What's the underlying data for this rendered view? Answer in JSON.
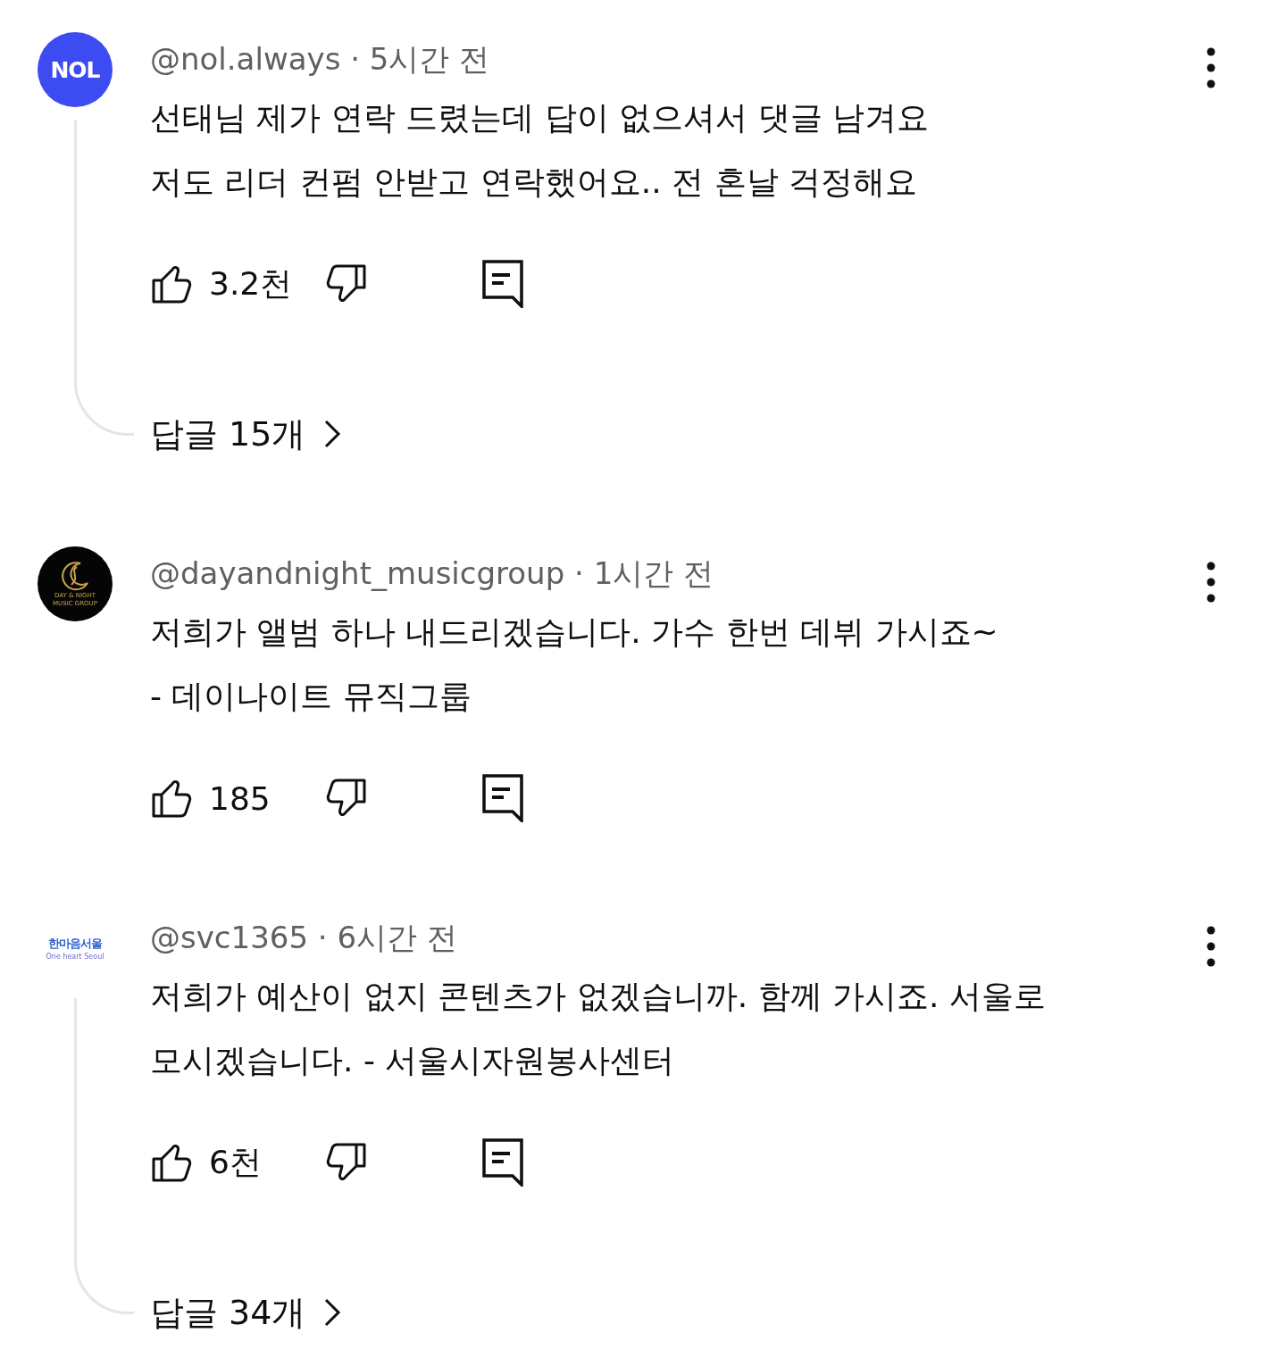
{
  "comments": [
    {
      "avatar": {
        "kind": "badge",
        "text": "NOL"
      },
      "header": "@nol.always · 5시간 전",
      "lines": [
        "선태님 제가 연락 드렸는데 답이 없으셔서 댓글 남겨요",
        "저도 리더 컨펌 안받고 연락했어요.. 전 혼날 걱정해요"
      ],
      "likes": "3.2천",
      "replies": "답글 15개"
    },
    {
      "avatar": {
        "kind": "emblem",
        "text": "DAY & NIGHT MUSIC GROUP"
      },
      "header": "@dayandnight_musicgroup · 1시간 전",
      "lines": [
        "저희가 앨범 하나 내드리겠습니다. 가수 한번 데뷔 가시죠~",
        "- 데이나이트 뮤직그룹"
      ],
      "likes": "185"
    },
    {
      "avatar": {
        "kind": "wordmark",
        "text": "한마음서울",
        "subtext": "One heart Seoul"
      },
      "header": "@svc1365 · 6시간 전",
      "lines": [
        "저희가 예산이 없지 콘텐츠가 없겠습니까. 함께 가시죠.  서울로",
        "모시겠습니다. - 서울시자원봉사센터"
      ],
      "likes": "6천",
      "replies": "답글 34개"
    }
  ]
}
